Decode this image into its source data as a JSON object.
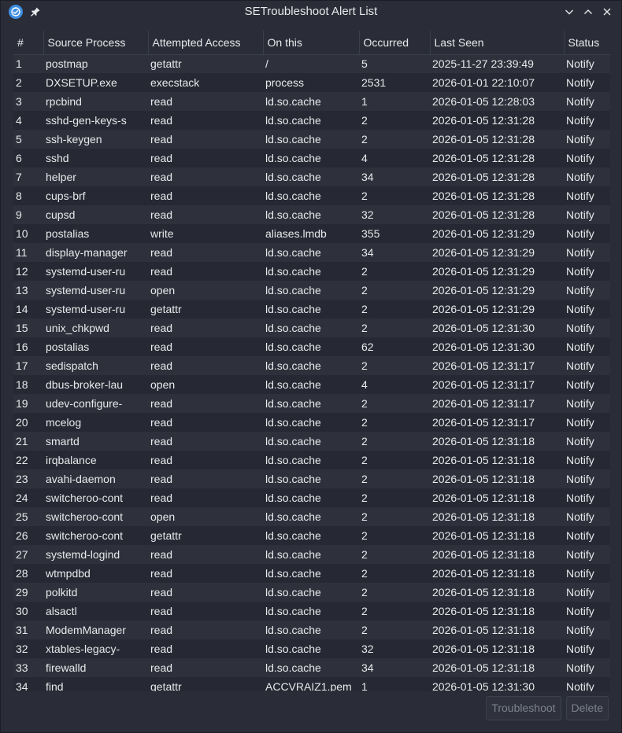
{
  "window": {
    "title": "SETroubleshoot Alert List"
  },
  "icons": {
    "app": "setroubleshoot-app-icon",
    "pin": "pin-icon",
    "minimize": "chevron-down-icon",
    "maximize": "chevron-up-icon",
    "close": "close-icon"
  },
  "colors": {
    "app_icon": "#3d8ee0",
    "background": "#2a2d37",
    "row_odd": "#2e313b",
    "row_even": "#262933"
  },
  "table": {
    "headers": [
      "#",
      "Source Process",
      "Attempted Access",
      "On this",
      "Occurred",
      "Last Seen",
      "Status"
    ],
    "rows": [
      [
        "1",
        "postmap",
        "getattr",
        "/",
        "5",
        "2025-11-27 23:39:49",
        "Notify"
      ],
      [
        "2",
        "DXSETUP.exe",
        "execstack",
        "process",
        "2531",
        "2026-01-01 22:10:07",
        "Notify"
      ],
      [
        "3",
        "rpcbind",
        "read",
        "ld.so.cache",
        "1",
        "2026-01-05 12:28:03",
        "Notify"
      ],
      [
        "4",
        "sshd-gen-keys-s",
        "read",
        "ld.so.cache",
        "2",
        "2026-01-05 12:31:28",
        "Notify"
      ],
      [
        "5",
        "ssh-keygen",
        "read",
        "ld.so.cache",
        "2",
        "2026-01-05 12:31:28",
        "Notify"
      ],
      [
        "6",
        "sshd",
        "read",
        "ld.so.cache",
        "4",
        "2026-01-05 12:31:28",
        "Notify"
      ],
      [
        "7",
        "helper",
        "read",
        "ld.so.cache",
        "34",
        "2026-01-05 12:31:28",
        "Notify"
      ],
      [
        "8",
        "cups-brf",
        "read",
        "ld.so.cache",
        "2",
        "2026-01-05 12:31:28",
        "Notify"
      ],
      [
        "9",
        "cupsd",
        "read",
        "ld.so.cache",
        "32",
        "2026-01-05 12:31:28",
        "Notify"
      ],
      [
        "10",
        "postalias",
        "write",
        "aliases.lmdb",
        "355",
        "2026-01-05 12:31:29",
        "Notify"
      ],
      [
        "11",
        "display-manager",
        "read",
        "ld.so.cache",
        "34",
        "2026-01-05 12:31:29",
        "Notify"
      ],
      [
        "12",
        "systemd-user-ru",
        "read",
        "ld.so.cache",
        "2",
        "2026-01-05 12:31:29",
        "Notify"
      ],
      [
        "13",
        "systemd-user-ru",
        "open",
        "ld.so.cache",
        "2",
        "2026-01-05 12:31:29",
        "Notify"
      ],
      [
        "14",
        "systemd-user-ru",
        "getattr",
        "ld.so.cache",
        "2",
        "2026-01-05 12:31:29",
        "Notify"
      ],
      [
        "15",
        "unix_chkpwd",
        "read",
        "ld.so.cache",
        "2",
        "2026-01-05 12:31:30",
        "Notify"
      ],
      [
        "16",
        "postalias",
        "read",
        "ld.so.cache",
        "62",
        "2026-01-05 12:31:30",
        "Notify"
      ],
      [
        "17",
        "sedispatch",
        "read",
        "ld.so.cache",
        "2",
        "2026-01-05 12:31:17",
        "Notify"
      ],
      [
        "18",
        "dbus-broker-lau",
        "open",
        "ld.so.cache",
        "4",
        "2026-01-05 12:31:17",
        "Notify"
      ],
      [
        "19",
        "udev-configure-",
        "read",
        "ld.so.cache",
        "2",
        "2026-01-05 12:31:17",
        "Notify"
      ],
      [
        "20",
        "mcelog",
        "read",
        "ld.so.cache",
        "2",
        "2026-01-05 12:31:17",
        "Notify"
      ],
      [
        "21",
        "smartd",
        "read",
        "ld.so.cache",
        "2",
        "2026-01-05 12:31:18",
        "Notify"
      ],
      [
        "22",
        "irqbalance",
        "read",
        "ld.so.cache",
        "2",
        "2026-01-05 12:31:18",
        "Notify"
      ],
      [
        "23",
        "avahi-daemon",
        "read",
        "ld.so.cache",
        "2",
        "2026-01-05 12:31:18",
        "Notify"
      ],
      [
        "24",
        "switcheroo-cont",
        "read",
        "ld.so.cache",
        "2",
        "2026-01-05 12:31:18",
        "Notify"
      ],
      [
        "25",
        "switcheroo-cont",
        "open",
        "ld.so.cache",
        "2",
        "2026-01-05 12:31:18",
        "Notify"
      ],
      [
        "26",
        "switcheroo-cont",
        "getattr",
        "ld.so.cache",
        "2",
        "2026-01-05 12:31:18",
        "Notify"
      ],
      [
        "27",
        "systemd-logind",
        "read",
        "ld.so.cache",
        "2",
        "2026-01-05 12:31:18",
        "Notify"
      ],
      [
        "28",
        "wtmpdbd",
        "read",
        "ld.so.cache",
        "2",
        "2026-01-05 12:31:18",
        "Notify"
      ],
      [
        "29",
        "polkitd",
        "read",
        "ld.so.cache",
        "2",
        "2026-01-05 12:31:18",
        "Notify"
      ],
      [
        "30",
        "alsactl",
        "read",
        "ld.so.cache",
        "2",
        "2026-01-05 12:31:18",
        "Notify"
      ],
      [
        "31",
        "ModemManager",
        "read",
        "ld.so.cache",
        "2",
        "2026-01-05 12:31:18",
        "Notify"
      ],
      [
        "32",
        "xtables-legacy-",
        "read",
        "ld.so.cache",
        "32",
        "2026-01-05 12:31:18",
        "Notify"
      ],
      [
        "33",
        "firewalld",
        "read",
        "ld.so.cache",
        "34",
        "2026-01-05 12:31:18",
        "Notify"
      ],
      [
        "34",
        "find",
        "getattr",
        "ACCVRAIZ1.pem",
        "1",
        "2026-01-05 12:31:30",
        "Notify"
      ]
    ]
  },
  "buttons": {
    "troubleshoot": "Troubleshoot",
    "delete": "Delete"
  }
}
